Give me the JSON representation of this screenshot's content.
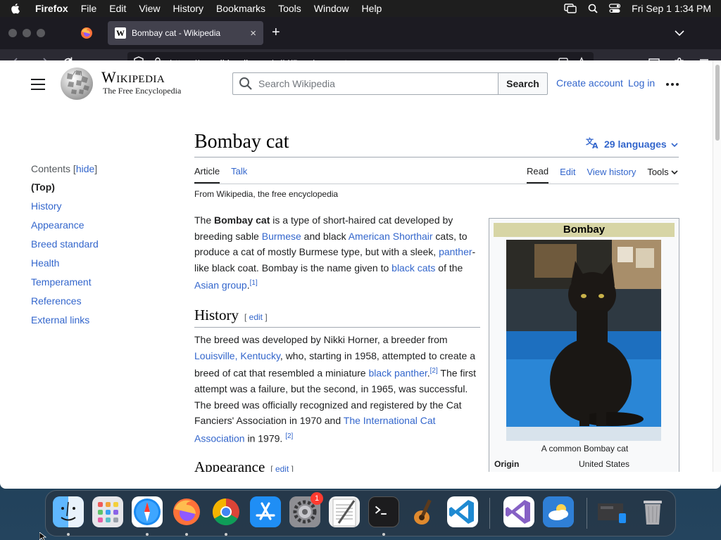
{
  "menubar": {
    "app": "Firefox",
    "items": [
      "File",
      "Edit",
      "View",
      "History",
      "Bookmarks",
      "Tools",
      "Window",
      "Help"
    ],
    "datetime": "Fri Sep 1  1:34 PM"
  },
  "browser": {
    "tab_title": "Bombay cat - Wikipedia",
    "tab_close": "×",
    "new_tab": "+",
    "url_prefix": "https://en.",
    "url_domain": "wikipedia.org",
    "url_path": "/wiki/Bombay_cat"
  },
  "header": {
    "wordmark": "Wikipedia",
    "tagline": "The Free Encyclopedia",
    "search_placeholder": "Search Wikipedia",
    "search_button": "Search",
    "create_account": "Create account",
    "login": "Log in"
  },
  "toc": {
    "title": "Contents",
    "hide": "hide",
    "items": [
      "(Top)",
      "History",
      "Appearance",
      "Breed standard",
      "Health",
      "Temperament",
      "References",
      "External links"
    ]
  },
  "article": {
    "title": "Bombay cat",
    "languages": "29 languages",
    "tabs_left": [
      "Article",
      "Talk"
    ],
    "tabs_right": [
      "Read",
      "Edit",
      "View history",
      "Tools"
    ],
    "from": "From Wikipedia, the free encyclopedia",
    "p1": {
      "t1": "The ",
      "b1": "Bombay cat",
      "t2": " is a type of short-haired cat developed by breeding sable ",
      "l1": "Burmese",
      "t3": " and black ",
      "l2": "American Shorthair",
      "t4": " cats, to produce a cat of mostly Burmese type, but with a sleek, ",
      "l3": "panther",
      "t5": "-like black coat. Bombay is the name given to ",
      "l4": "black cats",
      "t6": " of the ",
      "l5": "Asian group",
      "t7": ".",
      "ref": "[1]"
    },
    "h_history": "History",
    "edit_label": "edit",
    "p2": {
      "t1": "The breed was developed by Nikki Horner, a breeder from ",
      "l1": "Louisville, Kentucky",
      "t2": ", who, starting in 1958, attempted to create a breed of cat that resembled a miniature ",
      "l2": "black panther",
      "t3": ".",
      "ref1": "[2]",
      "t4": " The first attempt was a failure, but the second, in 1965, was successful. The breed was officially recognized and registered by the Cat Fanciers' Association in 1970 and ",
      "l3": "The International Cat Association",
      "t5": " in 1979. ",
      "ref2": "[2]"
    },
    "h_appearance": "Appearance"
  },
  "infobox": {
    "title": "Bombay",
    "caption": "A common Bombay cat",
    "origin_label": "Origin",
    "origin_value": "United States"
  },
  "dock": {
    "badge": "1",
    "apps": [
      "finder-icon",
      "launchpad-icon",
      "safari-icon",
      "firefox-icon",
      "chrome-icon",
      "app-store-icon",
      "system-settings-icon",
      "textedit-icon",
      "terminal-icon",
      "garageband-icon",
      "vscode-icon",
      "visual-studio-icon",
      "weather-icon",
      "screenshot-icon",
      "trash-icon"
    ]
  }
}
